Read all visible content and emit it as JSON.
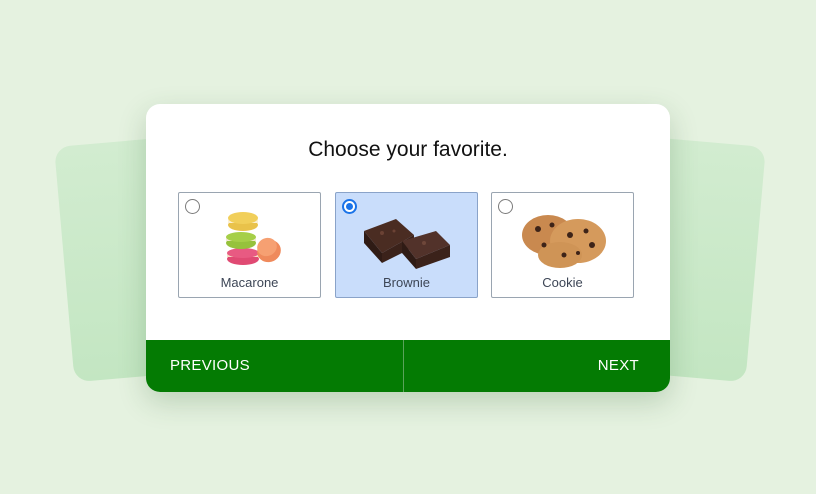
{
  "question": {
    "title": "Choose your favorite."
  },
  "options": [
    {
      "label": "Macarone",
      "selected": false
    },
    {
      "label": "Brownie",
      "selected": true
    },
    {
      "label": "Cookie",
      "selected": false
    }
  ],
  "footer": {
    "previous_label": "PREVIOUS",
    "next_label": "NEXT"
  },
  "colors": {
    "background": "#e5f2e0",
    "footer": "#047b03",
    "selected": "#c9ddfb",
    "radio": "#1a73e8"
  }
}
